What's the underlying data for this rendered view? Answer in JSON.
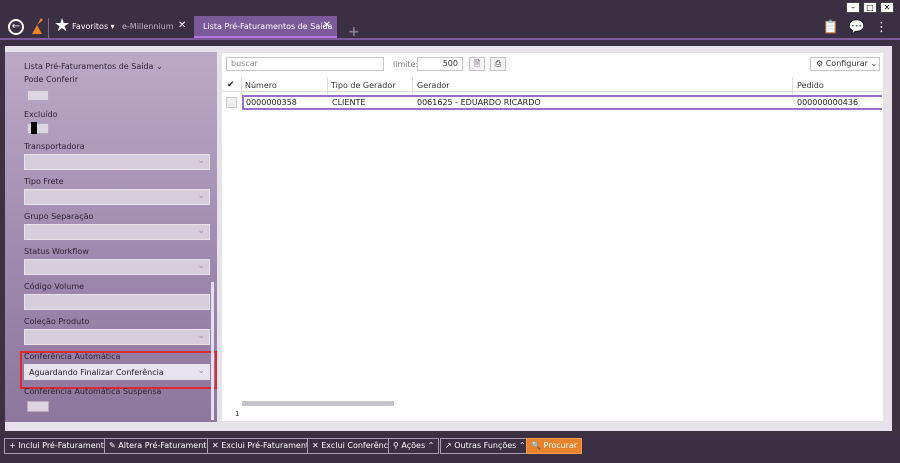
{
  "window": {
    "controls": [
      "–",
      "□",
      "✕"
    ]
  },
  "topbar": {
    "favorites_label": "Favoritos",
    "favorites_chevron": "▾",
    "tabs": [
      {
        "label": "e-Millennium"
      },
      {
        "label": "Lista Pré-Faturamentos de Saída"
      }
    ]
  },
  "filters": {
    "title": "Lista Pré-Faturamentos de Saída",
    "fields": [
      {
        "label": "Pode Conferir"
      },
      {
        "label": "Excluído"
      },
      {
        "label": "Transportadora"
      },
      {
        "label": "Tipo Frete"
      },
      {
        "label": "Grupo Separação"
      },
      {
        "label": "Status Workflow"
      },
      {
        "label": "Código Volume"
      },
      {
        "label": "Coleção Produto"
      },
      {
        "label": "Conferência Automática",
        "value": "Aguardando Finalizar Conferência"
      },
      {
        "label": "Conferência Automática Suspensa"
      }
    ]
  },
  "toolbar": {
    "search_placeholder": "buscar",
    "limite_label": "limite:",
    "limite_value": "500",
    "config_label": "Configurar"
  },
  "table": {
    "columns": [
      "Número",
      "Tipo de Gerador",
      "Gerador",
      "Pedido"
    ],
    "rows": [
      [
        "0000000358",
        "CLIENTE",
        "0061625 - EDUARDO RICARDO",
        "000000000436"
      ]
    ],
    "pager": "1"
  },
  "bottom": {
    "buttons": [
      "Inclui Pré-Faturamento",
      "Altera Pré-Faturamento",
      "Exclui Pré-Faturamento",
      "Exclui Conferência",
      "Ações",
      "Outras Funções",
      "Procurar"
    ]
  },
  "colors": {
    "accent": "#7c5a9a",
    "highlight": "#e0282f",
    "procurar": "#e8822b"
  }
}
